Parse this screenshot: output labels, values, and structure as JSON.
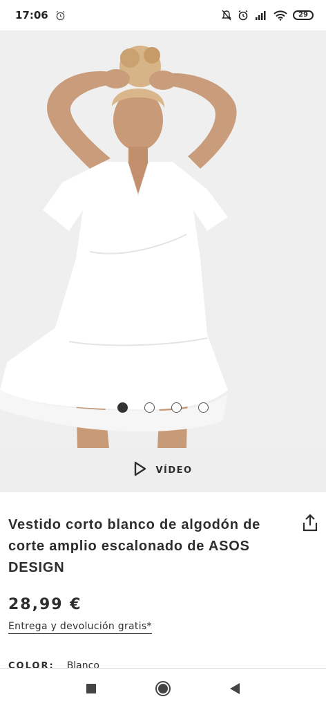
{
  "status_bar": {
    "time": "17:06",
    "battery": "29",
    "icons": [
      "alarm-icon",
      "mute-icon",
      "alarm-icon",
      "signal-icon",
      "wifi-icon",
      "battery-icon"
    ]
  },
  "gallery": {
    "image": "product-photo",
    "dot_count": 4,
    "active_index": 0
  },
  "video": {
    "label": "VÍDEO",
    "icon": "play-icon"
  },
  "product": {
    "title": "Vestido corto blanco de algodón de corte amplio escalonado de ASOS DESIGN",
    "price": "28,99 €",
    "delivery": "Entrega y devolución gratis*",
    "color_label": "COLOR:",
    "color_value": "Blanco"
  },
  "nav": {
    "icons": [
      "recents-icon",
      "home-icon",
      "back-icon"
    ]
  },
  "colors": {
    "accent": "#2d2d2d",
    "video_bar": "#eeeeee",
    "photo_bg": "#efefef"
  }
}
